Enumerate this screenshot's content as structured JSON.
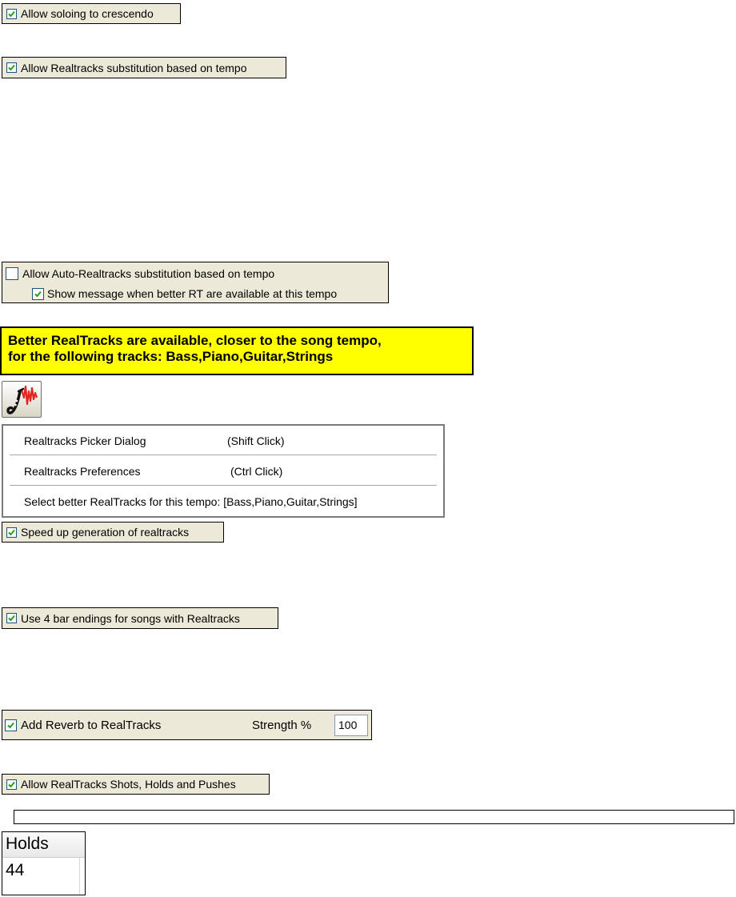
{
  "options": {
    "soloing_crescendo": {
      "label": "Allow soloing to crescendo",
      "checked": true
    },
    "rt_substitution_tempo": {
      "label": "Allow Realtracks substitution based on tempo",
      "checked": true
    },
    "auto_rt_substitution": {
      "label": "Allow Auto-Realtracks substitution based on tempo",
      "checked": false
    },
    "show_better_rt_message": {
      "label": "Show message when better RT are available at this tempo",
      "checked": true
    },
    "speed_up_generation": {
      "label": "Speed up generation of realtracks",
      "checked": true
    },
    "four_bar_endings": {
      "label": "Use 4 bar endings for songs with Realtracks",
      "checked": true
    },
    "add_reverb": {
      "label": "Add Reverb to RealTracks",
      "checked": true,
      "strength_label": "Strength %",
      "strength_value": "100"
    },
    "shots_holds_pushes": {
      "label": "Allow RealTracks Shots, Holds and Pushes",
      "checked": true
    }
  },
  "banner": {
    "line1": "Better RealTracks are available, closer to the song tempo,",
    "line2": "for the following tracks:  Bass,Piano,Guitar,Strings",
    "color": "#ffff00"
  },
  "realtracks_button": {
    "icon": "saxophone-waveform-icon"
  },
  "context_menu": {
    "items": [
      {
        "label": "Realtracks Picker Dialog",
        "shortcut": "(Shift Click)"
      },
      {
        "label": "Realtracks Preferences",
        "shortcut": "(Ctrl Click)"
      },
      {
        "label": "Select better RealTracks for this tempo: [Bass,Piano,Guitar,Strings]",
        "shortcut": ""
      }
    ]
  },
  "holds_column": {
    "header": "Holds",
    "value": "44"
  },
  "colors": {
    "panel": "#ece9d8",
    "check": "#21a121",
    "checkbox_border": "#1c5180"
  }
}
